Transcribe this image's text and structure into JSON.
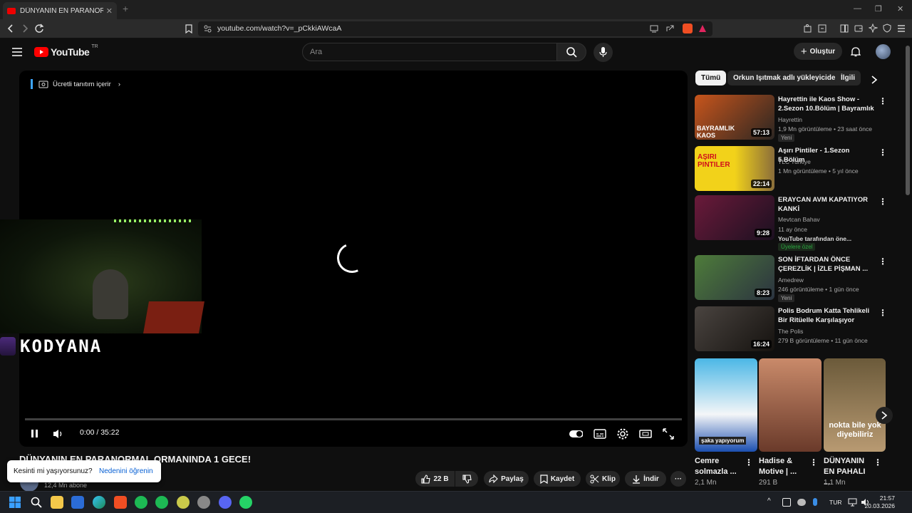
{
  "browser": {
    "tab_title": "DÜNYANIN EN PARANORMAL O",
    "url": "youtube.com/watch?v=_pCkkiAWcaA"
  },
  "header": {
    "logo_text": "YouTube",
    "logo_region": "TR",
    "search_placeholder": "Ara",
    "create_label": "Oluştur"
  },
  "player": {
    "promo_label": "Ücretli tanıtım içerir",
    "stream_name": "KODYANA",
    "time_display": "0:00 / 35:22",
    "progress": 0
  },
  "video": {
    "title": "DÜNYANIN EN PARANORMAL ORMANINDA 1 GECE!",
    "subscribers": "12,4 Mn abone",
    "likes": "22 B",
    "share_label": "Paylaş",
    "save_label": "Kaydet",
    "clip_label": "Klip",
    "download_label": "İndir"
  },
  "survey": {
    "question": "Kesinti mi yaşıyorsunuz?",
    "action": "Nedenini öğrenin"
  },
  "chips": [
    "Tümü",
    "Orkun Işıtmak adlı yükleyiciden",
    "İlgili"
  ],
  "recommendations": [
    {
      "title": "Hayrettin ile Kaos Show - 2.Sezon 10.Bölüm | Bayramlık ...",
      "channel": "Hayrettin",
      "meta": "1,9 Mn görüntüleme • 23 saat önce",
      "duration": "57:13",
      "badge": "Yeni",
      "thumb_text": "BAYRAMLIK KAOS",
      "colors": [
        "#c8551c",
        "#2b2622"
      ]
    },
    {
      "title": "Aşırı Pintiler - 1.Sezon 5.Bölüm",
      "channel": "TLC Turkiye",
      "meta": "1 Mn görüntüleme • 5 yıl önce",
      "duration": "22:14",
      "thumb_text": "AŞIRI PINTILER",
      "colors": [
        "#f2d21a",
        "#8a6d3a"
      ]
    },
    {
      "title": "ERAYCAN AVM KAPATIYOR KANKİ",
      "channel": "Mevtcan Bahav",
      "meta": "11 ay önce",
      "extra": "YouTube tarafından öne...",
      "member": "Üyelere özel",
      "duration": "9:28",
      "colors": [
        "#6b1a3a",
        "#1b1020"
      ]
    },
    {
      "title": "SON İFTARDAN ÖNCE ÇEREZLİK | İZLE PİŞMAN ...",
      "channel": "Amedrew",
      "meta": "246 görüntüleme • 1 gün önce",
      "duration": "8:23",
      "badge": "Yeni",
      "colors": [
        "#4e7c3a",
        "#2b3340"
      ]
    },
    {
      "title": "Polis Bodrum Katta Tehlikeli Bir Ritüelle Karşılaşıyor",
      "channel": "The Polis",
      "meta": "279 B görüntüleme • 11 gün önce",
      "duration": "16:24",
      "colors": [
        "#4a4440",
        "#15120f"
      ]
    }
  ],
  "shorts": [
    {
      "title": "Cemre solmazla ...",
      "views": "2,1 Mn",
      "caption": "şaka yapıyorum",
      "colors": [
        "#4bb7e6",
        "#f4f6f8"
      ]
    },
    {
      "title": "Hadise & Motive | ...",
      "views": "291 B",
      "colors": [
        "#c98a6a",
        "#6a3a2a"
      ]
    },
    {
      "title": "DÜNYANIN EN PAHALI ...",
      "views": "1,1 Mn",
      "caption": "nokta bile yok diyebiliriz",
      "colors": [
        "#6b5a3a",
        "#b89a72"
      ]
    }
  ],
  "taskbar": {
    "lang": "TUR",
    "time": "21:57",
    "date": "20.03.2026"
  }
}
